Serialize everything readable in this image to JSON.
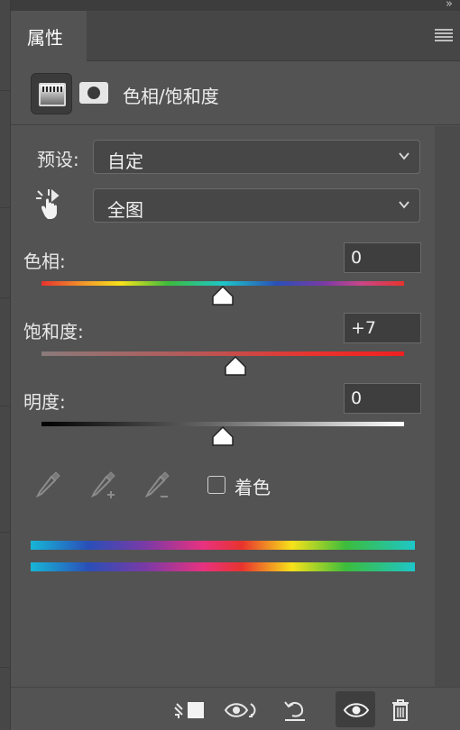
{
  "tab": {
    "title": "属性"
  },
  "panel": {
    "title": "色相/饱和度"
  },
  "preset": {
    "label": "预设:",
    "value": "自定"
  },
  "channel": {
    "value": "全图"
  },
  "hue": {
    "label": "色相:",
    "value": "0",
    "level": 0
  },
  "saturation": {
    "label": "饱和度:",
    "value": "+7",
    "level": 7
  },
  "lightness": {
    "label": "明度:",
    "value": "0",
    "level": 0
  },
  "colorize": {
    "label": "着色",
    "checked": false
  },
  "icons": {
    "collapse": "double-chevron-right-icon",
    "menu": "hamburger-menu-icon",
    "adjustment": "hue-saturation-adjustment-icon",
    "mask": "layer-mask-icon",
    "targeted_adjust": "hand-targeted-adjustment-icon",
    "eyedroppers": [
      "eyedropper-icon",
      "eyedropper-add-icon",
      "eyedropper-subtract-icon"
    ],
    "bottom": [
      "clip-to-layer-icon",
      "view-previous-state-icon",
      "reset-icon",
      "toggle-visibility-icon",
      "delete-icon"
    ]
  },
  "colors": {
    "panel_bg": "#535353",
    "accent_red": "#e8332e"
  }
}
